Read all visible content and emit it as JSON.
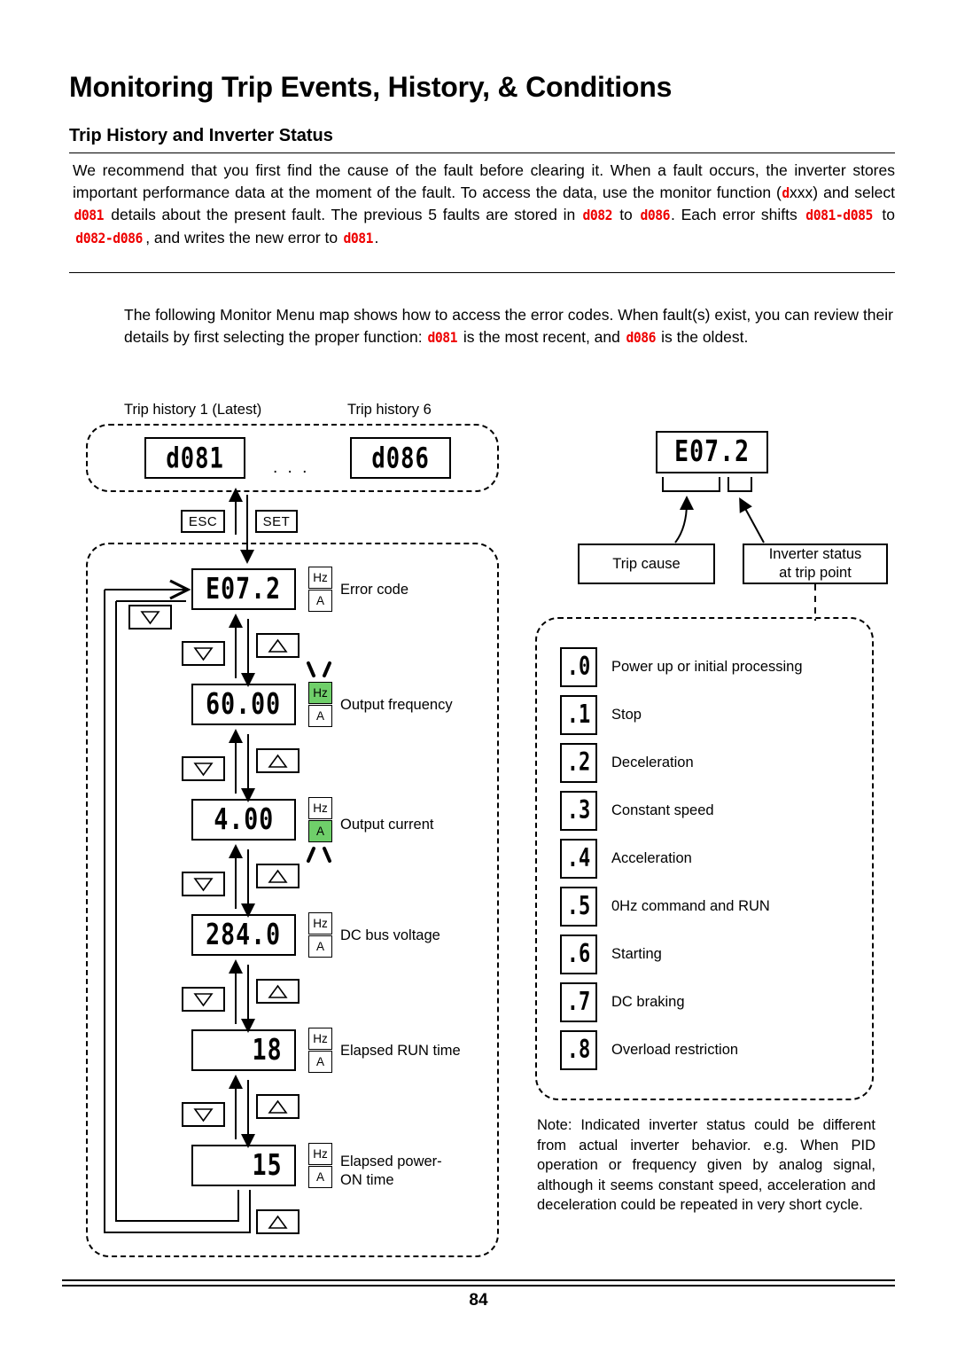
{
  "header": {
    "title": "Monitoring Trip Events, History, & Conditions",
    "subtitle": "Trip History and Inverter Status"
  },
  "intro": {
    "line1_a": "We recommend that you first find the cause of the fault before clearing it. When a fault occurs, the inverter stores important performance data at the moment of the fault. To access the data, use the monitor function (",
    "code_d": "d",
    "line1_b": "xxx) and select ",
    "code_d081": "d081",
    "line1_c": " details about the present fault. The previous 5 faults are stored in ",
    "code_d082": "d082",
    "line1_d": " to ",
    "code_d086": "d086",
    "line1_e": ". Each error shifts ",
    "code_d081_d085": "d081-d085",
    "line1_f": " to ",
    "code_d082_d086": "d082-d086",
    "line1_g": ", and writes the new error to ",
    "code_d081_end": "d081",
    "line1_h": "."
  },
  "intro2": {
    "a": "The following Monitor Menu map shows how to access the error codes. When fault(s) exist, you can review their details by first selecting the proper function: ",
    "code1": "d081",
    "b": " is the most recent, and ",
    "code2": "d086",
    "c": " is the oldest."
  },
  "history": {
    "label_first": "Trip history 1 (Latest)",
    "label_last": "Trip history 6",
    "display_first": "d081",
    "display_last": "d086",
    "ellipsis": ". . ."
  },
  "keys": {
    "esc": "ESC",
    "set": "SET",
    "up": "up-arrow",
    "down": "down-arrow"
  },
  "monitor_chain": [
    {
      "value": "E07.2",
      "label": "Error code",
      "hz_on": false,
      "a_on": false,
      "blink": "none"
    },
    {
      "value": "60.00",
      "label": "Output frequency",
      "hz_on": true,
      "a_on": false,
      "blink": "hz"
    },
    {
      "value": "4.00",
      "label": "Output current",
      "hz_on": false,
      "a_on": true,
      "blink": "a"
    },
    {
      "value": "284.0",
      "label": "DC bus voltage",
      "hz_on": false,
      "a_on": false,
      "blink": "none"
    },
    {
      "value": "18",
      "label": "Elapsed RUN time",
      "hz_on": false,
      "a_on": false,
      "blink": "none"
    },
    {
      "value": "15",
      "label": "Elapsed power-\nON time",
      "hz_on": false,
      "a_on": false,
      "blink": "none"
    }
  ],
  "units": {
    "hz": "Hz",
    "a": "A"
  },
  "callouts": {
    "display": "E07.2",
    "trip_cause": "Trip cause",
    "inverter_status": "Inverter status\nat trip point"
  },
  "status_codes": [
    {
      "code": ".0",
      "desc": "Power up or initial processing"
    },
    {
      "code": ".1",
      "desc": "Stop"
    },
    {
      "code": ".2",
      "desc": "Deceleration"
    },
    {
      "code": ".3",
      "desc": "Constant speed"
    },
    {
      "code": ".4",
      "desc": "Acceleration"
    },
    {
      "code": ".5",
      "desc": "0Hz command and RUN"
    },
    {
      "code": ".6",
      "desc": "Starting"
    },
    {
      "code": ".7",
      "desc": "DC braking"
    },
    {
      "code": ".8",
      "desc": "Overload restriction"
    }
  ],
  "note": "Note: Indicated inverter status could be different from actual inverter behavior. e.g. When PID operation or frequency given by analog signal, although it seems constant speed, acceleration and deceleration could be repeated in very short cycle.",
  "footer": {
    "page_number": "84"
  },
  "colors": {
    "accent_green": "#6fcf6a",
    "code_red": "#ee0000"
  }
}
